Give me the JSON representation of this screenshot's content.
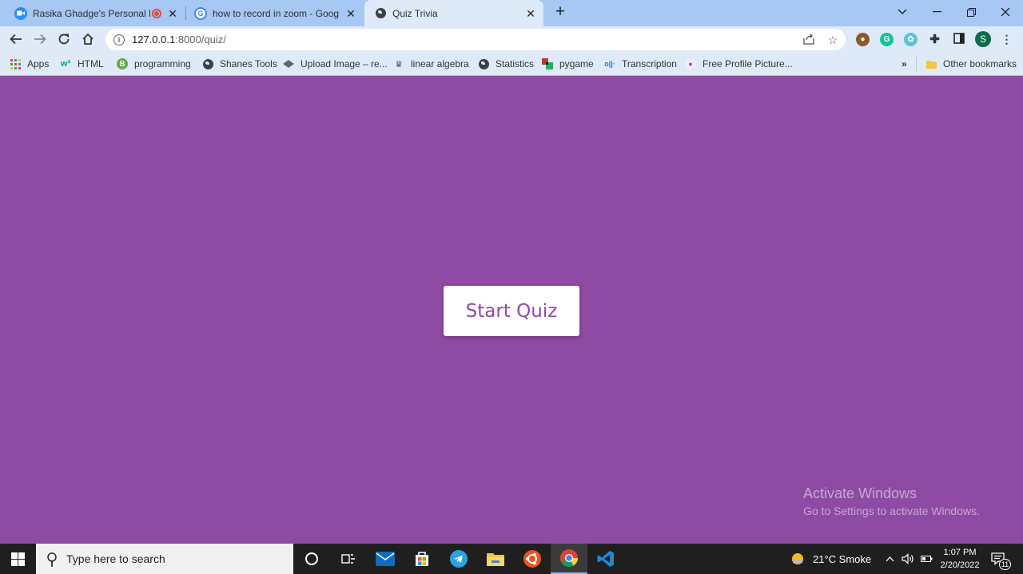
{
  "browser": {
    "tabs": [
      {
        "title": "Rasika Ghadge's Personal Me",
        "icon": "zoom-icon"
      },
      {
        "title": "how to record in zoom - Google",
        "icon": "google-icon"
      },
      {
        "title": "Quiz Trivia",
        "icon": "globe-icon"
      }
    ],
    "url": {
      "host": "127.0.0.1",
      "rest": ":8000/quiz/"
    },
    "profile_initial": "S"
  },
  "bookmarks": [
    {
      "label": "Apps",
      "icon": "apps-grid-icon"
    },
    {
      "label": "HTML",
      "icon": "w3-icon"
    },
    {
      "label": "programming",
      "icon": "bookmark-b-icon"
    },
    {
      "label": "Shanes Tools",
      "icon": "globe-icon"
    },
    {
      "label": "Upload Image – re...",
      "icon": "upload-icon"
    },
    {
      "label": "linear algebra",
      "icon": "crown-icon"
    },
    {
      "label": "Statistics",
      "icon": "globe-icon"
    },
    {
      "label": "pygame",
      "icon": "pygame-icon"
    },
    {
      "label": "Transcription",
      "icon": "otter-icon"
    },
    {
      "label": "Free Profile Picture...",
      "icon": "profile-icon"
    }
  ],
  "bookmarks_overflow": "»",
  "other_bookmarks": "Other bookmarks",
  "page": {
    "start_button": "Start Quiz",
    "background_color": "#8e4ba3",
    "watermark_line1": "Activate Windows",
    "watermark_line2": "Go to Settings to activate Windows."
  },
  "taskbar": {
    "search_placeholder": "Type here to search",
    "weather": "21°C  Smoke",
    "time": "1:07 PM",
    "date": "2/20/2022",
    "notifications": "11"
  }
}
